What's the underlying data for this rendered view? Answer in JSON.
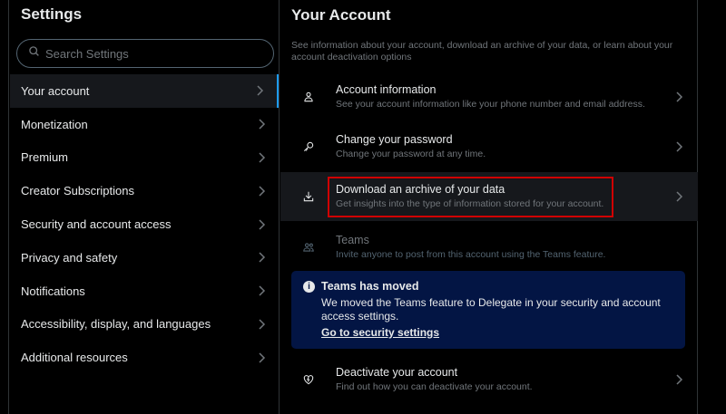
{
  "sidebar": {
    "title": "Settings",
    "search_placeholder": "Search Settings",
    "items": [
      {
        "label": "Your account"
      },
      {
        "label": "Monetization"
      },
      {
        "label": "Premium"
      },
      {
        "label": "Creator Subscriptions"
      },
      {
        "label": "Security and account access"
      },
      {
        "label": "Privacy and safety"
      },
      {
        "label": "Notifications"
      },
      {
        "label": "Accessibility, display, and languages"
      },
      {
        "label": "Additional resources"
      }
    ]
  },
  "main": {
    "title": "Your Account",
    "intro": "See information about your account, download an archive of your data, or learn about your account deactivation options",
    "rows": [
      {
        "icon": "person-icon",
        "title": "Account information",
        "subtitle": "See your account information like your phone number and email address."
      },
      {
        "icon": "key-icon",
        "title": "Change your password",
        "subtitle": "Change your password at any time."
      },
      {
        "icon": "download-icon",
        "title": "Download an archive of your data",
        "subtitle": "Get insights into the type of information stored for your account."
      },
      {
        "icon": "people-icon",
        "title": "Teams",
        "subtitle": "Invite anyone to post from this account using the Teams feature."
      },
      {
        "icon": "broken-heart-icon",
        "title": "Deactivate your account",
        "subtitle": "Find out how you can deactivate your account."
      }
    ],
    "notice": {
      "icon": "info-icon",
      "title": "Teams has moved",
      "body": "We moved the Teams feature to Delegate in your security and account access settings.",
      "link": "Go to security settings"
    }
  },
  "colors": {
    "background": "#000000",
    "selected_row": "#16181c",
    "notice_background": "#031544",
    "highlight_box": "#d00000",
    "accent": "#1d9bf0"
  }
}
